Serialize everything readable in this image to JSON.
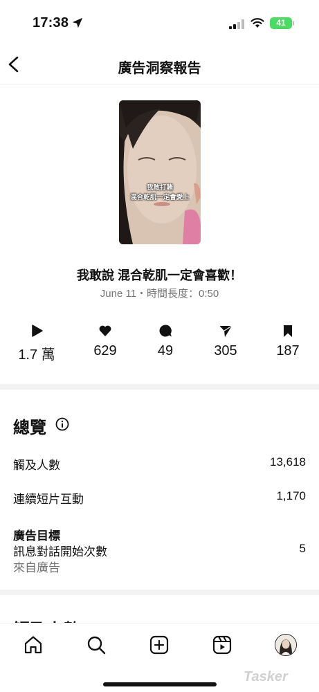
{
  "status_bar": {
    "time": "17:38",
    "battery": "41"
  },
  "header": {
    "title": "廣告洞察報告"
  },
  "media": {
    "caption_line1": "我敢打賭",
    "caption_line2": "混合乾肌一定會愛上"
  },
  "post": {
    "title": "我敢說 混合乾肌一定會喜歡！",
    "meta": "June 11・時間長度：0:50"
  },
  "stats": [
    {
      "icon": "play-icon",
      "value": "1.7 萬"
    },
    {
      "icon": "heart-icon",
      "value": "629"
    },
    {
      "icon": "comment-icon",
      "value": "49"
    },
    {
      "icon": "share-icon",
      "value": "305"
    },
    {
      "icon": "bookmark-icon",
      "value": "187"
    }
  ],
  "overview": {
    "title": "總覽",
    "rows": [
      {
        "label": "觸及人數",
        "value": "13,618"
      },
      {
        "label": "連續短片互動",
        "value": "1,170"
      }
    ],
    "goal": {
      "heading": "廣告目標",
      "label": "訊息對話開始次數",
      "sublabel": "來自廣告",
      "value": "5"
    }
  },
  "next_section": {
    "title": "觸及人數"
  },
  "tabbar": [
    "home-icon",
    "search-icon",
    "create-icon",
    "reels-icon",
    "profile-avatar"
  ],
  "watermark": "Tasker"
}
